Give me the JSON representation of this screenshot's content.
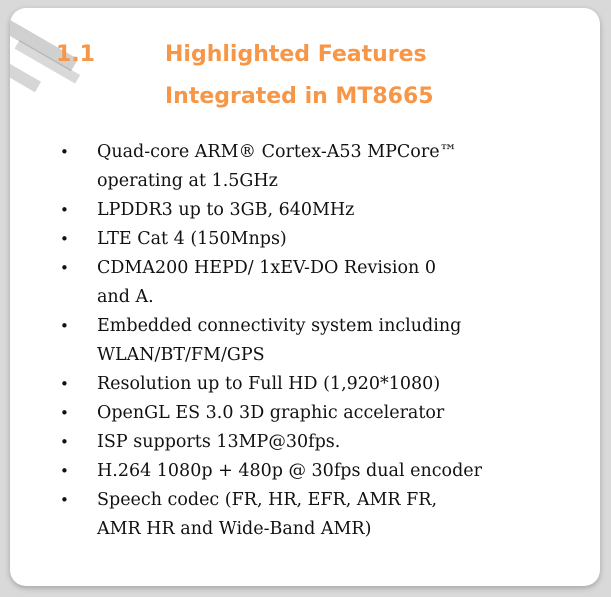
{
  "section": {
    "number": "1.1",
    "title_line1": "Highlighted Features",
    "title_line2": "Integrated in MT8665"
  },
  "features": [
    {
      "lines": [
        "Quad-core ARM® Cortex-A53 MPCore™",
        "operating at 1.5GHz"
      ]
    },
    {
      "lines": [
        "LPDDR3 up to 3GB, 640MHz"
      ]
    },
    {
      "lines": [
        "LTE Cat 4 (150Mnps)"
      ]
    },
    {
      "lines": [
        "CDMA200 HEPD/ 1xEV-DO Revision 0",
        "and A."
      ]
    },
    {
      "lines": [
        "Embedded connectivity system including",
        "WLAN/BT/FM/GPS"
      ]
    },
    {
      "lines": [
        "Resolution up to Full HD (1,920*1080)"
      ]
    },
    {
      "lines": [
        "OpenGL ES 3.0 3D graphic accelerator"
      ]
    },
    {
      "lines": [
        "ISP supports 13MP@30fps."
      ]
    },
    {
      "lines": [
        "H.264 1080p + 480p @ 30fps dual encoder"
      ]
    },
    {
      "lines": [
        "Speech codec (FR, HR, EFR, AMR FR,",
        "AMR HR and Wide-Band AMR)"
      ]
    }
  ],
  "bullet_glyph": "•",
  "colors": {
    "heading": "#F79646",
    "text": "#111111",
    "background": "#ffffff"
  }
}
